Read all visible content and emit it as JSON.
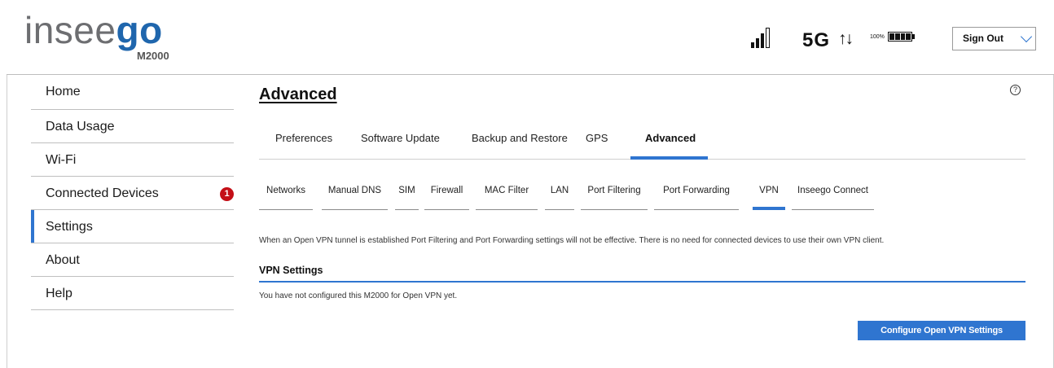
{
  "header": {
    "brand_prefix": "insee",
    "brand_suffix": "go",
    "model": "M2000",
    "network": "5G",
    "data_arrows": "↑↓",
    "battery_percent": "100%",
    "signout_label": "Sign Out",
    "signal_icon": "signal-bars-icon",
    "battery_icon": "battery-full-icon"
  },
  "sidebar": {
    "items": [
      {
        "label": "Home"
      },
      {
        "label": "Data Usage"
      },
      {
        "label": "Wi-Fi"
      },
      {
        "label": "Connected Devices",
        "badge": "1"
      },
      {
        "label": "Settings",
        "active": true
      },
      {
        "label": "About"
      },
      {
        "label": "Help"
      }
    ]
  },
  "main": {
    "title": "Advanced",
    "help_glyph": "?",
    "tabs": [
      {
        "label": "Preferences"
      },
      {
        "label": "Software Update"
      },
      {
        "label": "Backup and Restore"
      },
      {
        "label": "GPS"
      },
      {
        "label": "Advanced",
        "active": true
      }
    ],
    "subtabs": [
      {
        "label": "Networks"
      },
      {
        "label": "Manual DNS"
      },
      {
        "label": "SIM"
      },
      {
        "label": "Firewall"
      },
      {
        "label": "MAC Filter"
      },
      {
        "label": "LAN"
      },
      {
        "label": "Port Filtering"
      },
      {
        "label": "Port Forwarding"
      },
      {
        "label": "VPN",
        "active": true
      },
      {
        "label": "Inseego Connect"
      }
    ],
    "note": "When an Open VPN tunnel is established Port Filtering and Port Forwarding settings will not be effective. There is no need for connected devices to use their own VPN client.",
    "section_title": "VPN Settings",
    "status": "You have not configured this M2000 for Open VPN yet.",
    "configure_button": "Configure Open VPN Settings"
  },
  "colors": {
    "accent": "#2f75d0",
    "brand_blue": "#1f66ad",
    "brand_gray": "#6d6e71",
    "badge_red": "#c40f17"
  }
}
